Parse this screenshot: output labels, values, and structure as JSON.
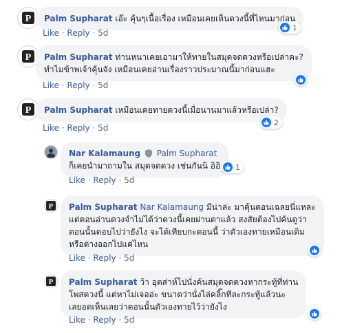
{
  "common": {
    "like": "Like",
    "reply": "Reply",
    "dot": "·"
  },
  "comments": [
    {
      "author": "Palm Supharat",
      "lines": [
        "เอ๊ะ คุ้นๆเนื้อเรื่อง เหมือนเคยเห็นดวงนี้ที่ไหนมาก่อน"
      ],
      "time": "5d",
      "reactions": "1",
      "avatar_letter": "P"
    },
    {
      "author": "Palm Supharat",
      "lines": [
        "ท่านหนาเคยเอามาให้ทายในสมุดจดดวงหรือเปล่าคะ?",
        "ทำไมข้าพเจ้าคุ้นจัง เหมือนเคยอ่านเรื่องราวประมาณนี้มาก่อนแฮะ"
      ],
      "time": "5d",
      "reactions": "",
      "avatar_letter": "P"
    },
    {
      "author": "Palm Supharat",
      "lines": [
        "เหมือนเคยทายดวงนี้เมื่อนานมาแล้วหรือเปล่า?"
      ],
      "time": "5d",
      "reactions": "2",
      "avatar_letter": "P"
    }
  ],
  "replies": [
    {
      "author": "Nar Kalamaung",
      "mention": "Palm Supharat",
      "lines": [
        "ก็เคยนำมาถามใน สมุดจดดวง เช่นกันนิ อิอิ"
      ],
      "time": "5d",
      "reactions": "1",
      "avatar_letter": "N"
    },
    {
      "author": "Palm Supharat",
      "mention": "Nar Kalamaung",
      "lines": [
        "มีน่าล่ะ มาคุ้นตอนเฉลยนี่แหละ",
        "แต่ตอนอ่านดวงจำไม่ได้ว่าดวงนี้เคยผ่านตาแล้ว สงสัยต้องไปค้นดูว่า",
        "ตอนนั้นตอบไปว่ายังไง จะได้เทียบกะตอนนี้ ว่าตัวเองทายเหมือนเดิม",
        "หรือต่างออกไปแค่ไหน"
      ],
      "time": "5d",
      "reactions": "",
      "avatar_letter": "P"
    },
    {
      "author": "Palm Supharat",
      "mention": "",
      "lines": [
        "ว้า อุตส่าห์ไปนั่งค้นสมุดจดดวงหากระทู้ที่ท่าน",
        "โพสดวงนี้ แต่หาไม่เจออ่ะ ขนาดว่านั่งไล่คลิ๊กทีละกระทู้แล้วนะ",
        "เลยอดเห็นเลยว่าตอนนั้นตัวเองทายไว้ว่ายังไง"
      ],
      "time": "5d",
      "reactions": "",
      "avatar_letter": "P"
    }
  ],
  "colors": {
    "name": "#385898",
    "like_blue": "#1877f2",
    "bubble": "#f2f3f5"
  },
  "icons": {
    "reaction": "thumbs-up-icon",
    "verified": "shield-icon"
  }
}
